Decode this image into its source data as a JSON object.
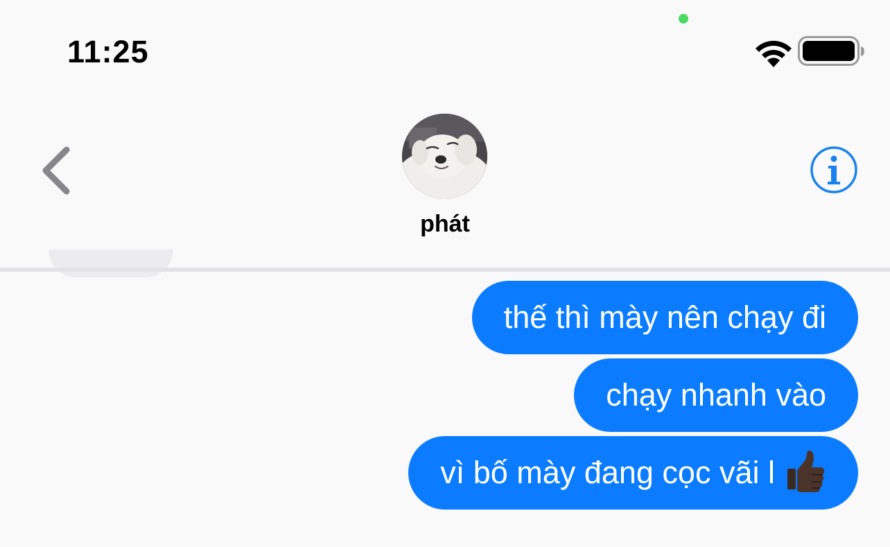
{
  "status_bar": {
    "time": "11:25",
    "camera_indicator_color": "#4cd964",
    "wifi_icon": "wifi-icon",
    "battery_icon": "battery-full-icon"
  },
  "header": {
    "contact_name": "phát",
    "back_icon": "chevron-left-icon",
    "info_icon": "info-circle-icon",
    "avatar_description": "avatar"
  },
  "messages": [
    {
      "text": "thế thì mày nên chạy đi",
      "sender": "me"
    },
    {
      "text": "chạy nhanh vào",
      "sender": "me"
    },
    {
      "text": "vì bố mày đang cọc vãi l",
      "sender": "me",
      "emoji": "thumbs-up-icon"
    }
  ],
  "colors": {
    "bubble_blue": "#0b7cff",
    "background": "#f9f9f9",
    "accent_blue": "#1a82ee",
    "back_chevron": "#86868b"
  }
}
